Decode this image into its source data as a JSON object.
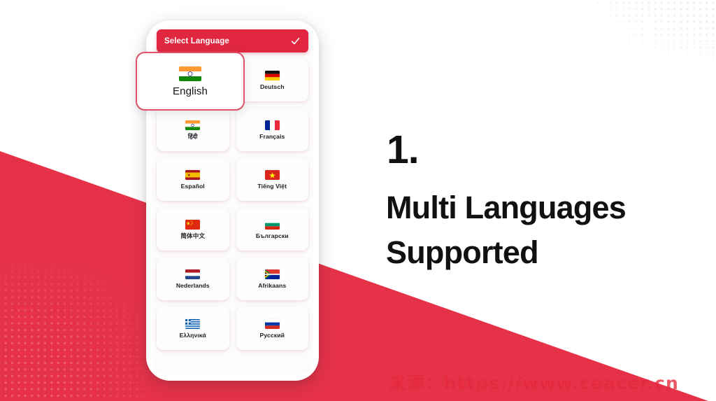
{
  "theme": {
    "brand_red": "#e0273f",
    "diagonal_red": "#e63249",
    "selected_border": "#e0506a",
    "text_dark": "#111114"
  },
  "phone": {
    "appbar": {
      "title": "Select Language",
      "confirm_icon": "check-icon"
    },
    "selected_language": {
      "label": "English",
      "flag": "flag-india"
    },
    "languages": [
      {
        "label": "Deutsch",
        "flag": "flag-germany"
      },
      {
        "label": "हिंदी",
        "flag": "flag-india"
      },
      {
        "label": "Français",
        "flag": "flag-france"
      },
      {
        "label": "Español",
        "flag": "flag-spain"
      },
      {
        "label": "Tiếng Việt",
        "flag": "flag-vietnam"
      },
      {
        "label": "简体中文",
        "flag": "flag-china"
      },
      {
        "label": "Български",
        "flag": "flag-bulgaria"
      },
      {
        "label": "Nederlands",
        "flag": "flag-netherlands"
      },
      {
        "label": "Afrikaans",
        "flag": "flag-southafrica"
      },
      {
        "label": "Ελληνικά",
        "flag": "flag-greece"
      },
      {
        "label": "Русский",
        "flag": "flag-russia"
      }
    ]
  },
  "feature": {
    "number": "1.",
    "title": "Multi Languages Supported"
  },
  "watermark": {
    "text": "来源：https://www.ceacer.cn"
  }
}
